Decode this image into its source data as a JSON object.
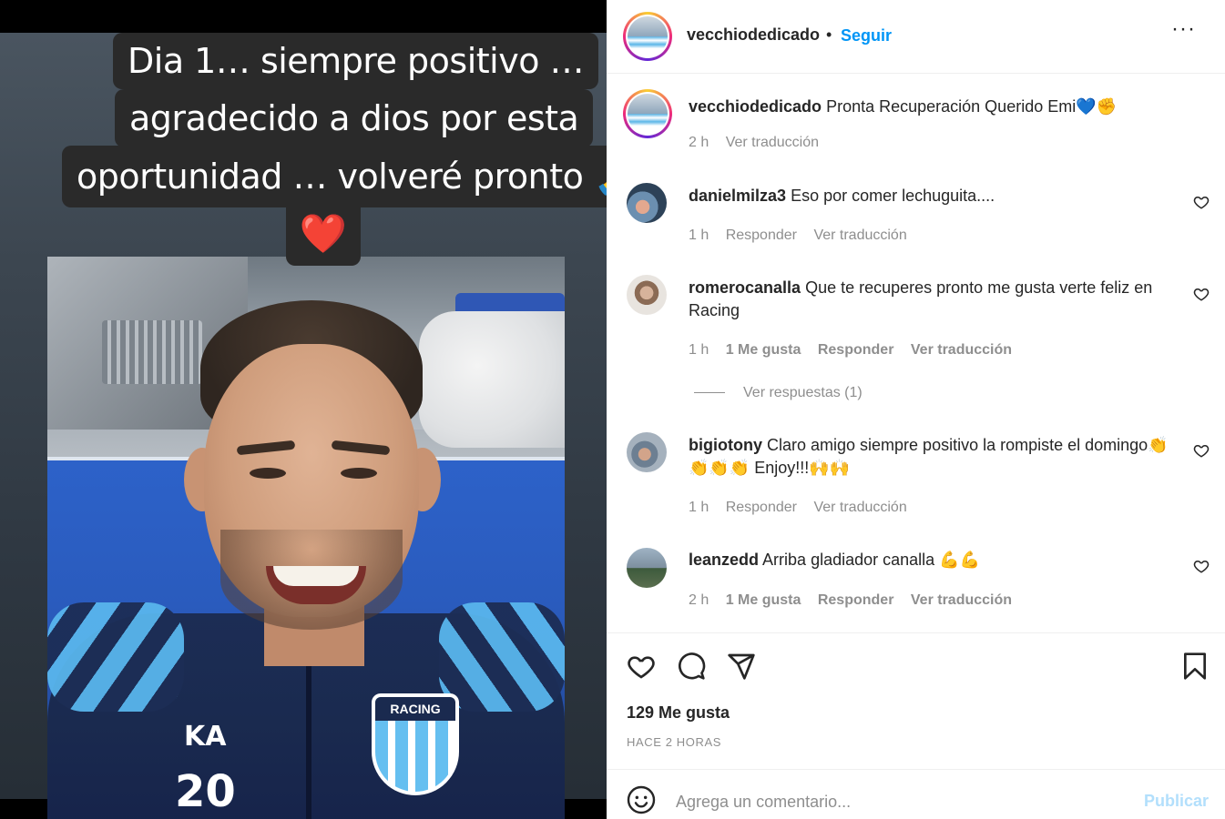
{
  "story": {
    "caption_lines": [
      "Dia 1… siempre positivo …",
      "agradecido a dios por esta",
      "oportunidad … volveré pronto 🙏"
    ],
    "heart": "❤️",
    "jersey_number": "20",
    "crest_text": "RACING",
    "brand_text": "KA"
  },
  "header": {
    "username": "vecchiodedicado",
    "separator": "•",
    "follow_label": "Seguir",
    "more_label": "···"
  },
  "caption": {
    "username": "vecchiodedicado",
    "text": "Pronta Recuperación Querido Emi💙✊",
    "time": "2 h",
    "translate": "Ver traducción"
  },
  "comments": [
    {
      "username": "danielmilza3",
      "text": "Eso por comer lechuguita....",
      "time": "1 h",
      "likes": "",
      "reply": "Responder",
      "translate": "Ver traducción"
    },
    {
      "username": "romerocanalla",
      "text": "Que te recuperes pronto me gusta verte feliz en Racing",
      "time": "1 h",
      "likes": "1 Me gusta",
      "reply": "Responder",
      "translate": "Ver traducción",
      "view_replies": "Ver respuestas (1)"
    },
    {
      "username": "bigiotony",
      "text": "Claro amigo siempre positivo la rompiste el domingo👏👏👏👏 Enjoy!!!🙌🙌",
      "time": "1 h",
      "likes": "",
      "reply": "Responder",
      "translate": "Ver traducción"
    },
    {
      "username": "leanzedd",
      "text": "Arriba gladiador canalla 💪💪",
      "time": "2 h",
      "likes": "1 Me gusta",
      "reply": "Responder",
      "translate": "Ver traducción"
    }
  ],
  "footer": {
    "likes": "129 Me gusta",
    "when": "HACE 2 HORAS",
    "comment_placeholder": "Agrega un comentario...",
    "publish_label": "Publicar"
  },
  "icons": {
    "like": "heart-icon",
    "comment": "comment-icon",
    "share": "share-icon",
    "save": "bookmark-icon",
    "emoji": "emoji-icon"
  },
  "colors": {
    "accent": "#0095f6",
    "publish_disabled": "#b2dffc",
    "muted": "#8e8e8e"
  }
}
